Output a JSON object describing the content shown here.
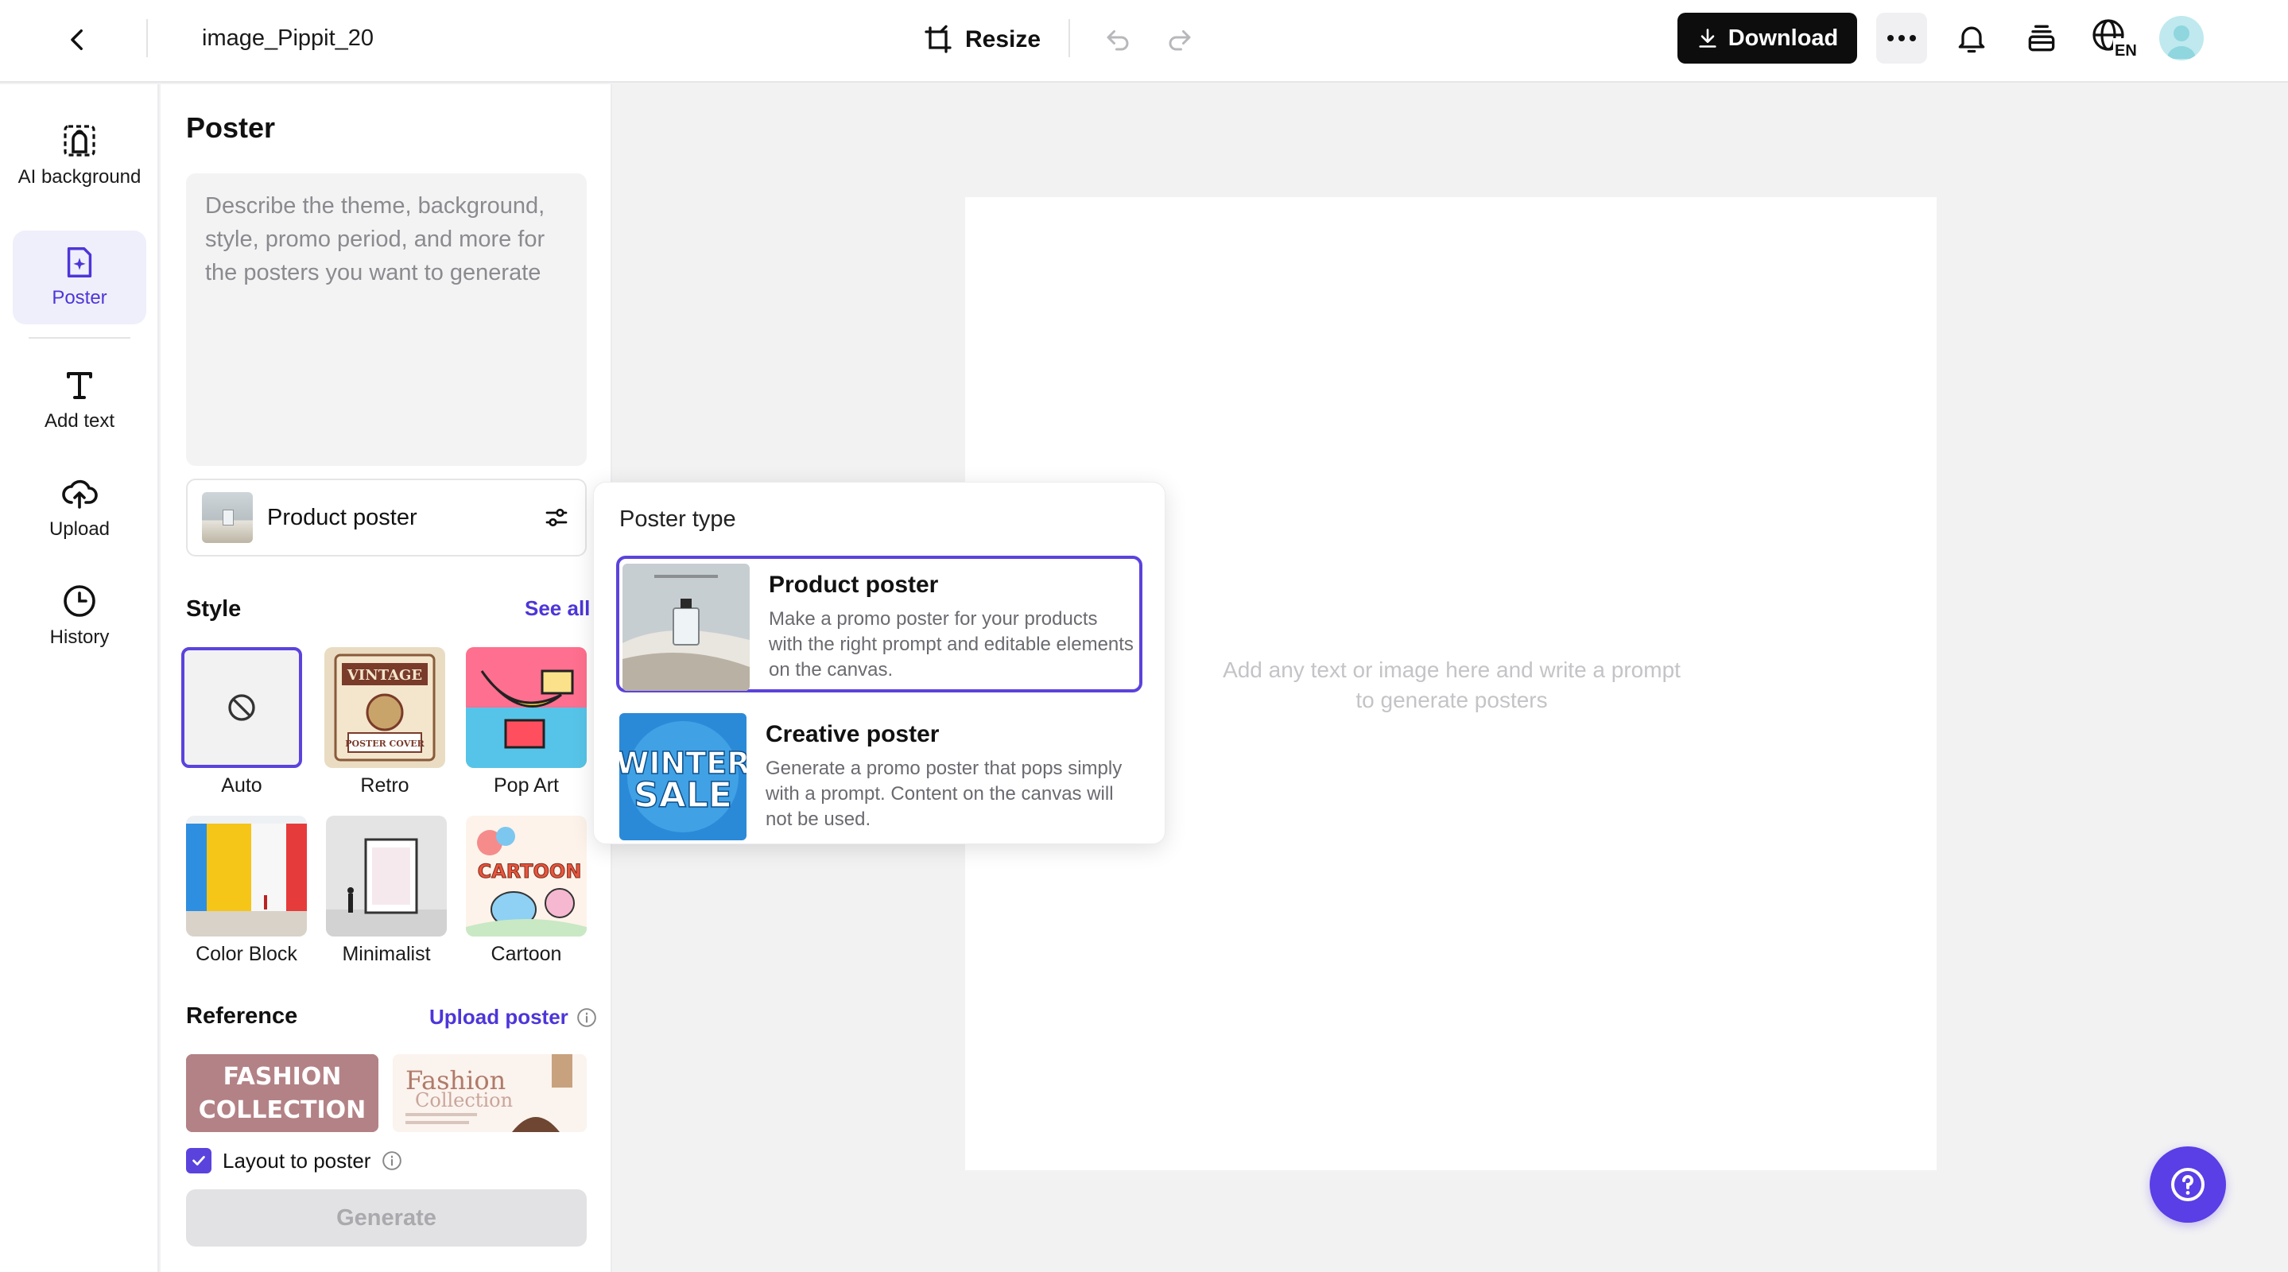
{
  "header": {
    "title": "image_Pippit_20",
    "resize_label": "Resize",
    "download_label": "Download",
    "language": "EN"
  },
  "rail": {
    "items": [
      {
        "label": "AI background",
        "icon": "ai-background-icon"
      },
      {
        "label": "Poster",
        "icon": "poster-icon",
        "active": true
      },
      {
        "label": "Add text",
        "icon": "text-icon"
      },
      {
        "label": "Upload",
        "icon": "upload-cloud-icon"
      },
      {
        "label": "History",
        "icon": "clock-icon"
      }
    ]
  },
  "panel": {
    "title": "Poster",
    "prompt_placeholder": "Describe the theme, background, style, promo period, and more for the posters you want to generate",
    "poster_type_selected": "Product poster",
    "style": {
      "title": "Style",
      "see_all": "See all",
      "options": [
        "Auto",
        "Retro",
        "Pop Art",
        "Color Block",
        "Minimalist",
        "Cartoon"
      ],
      "selected": "Auto"
    },
    "reference": {
      "title": "Reference",
      "upload_label": "Upload poster",
      "items": [
        {
          "text_line1": "FASHION",
          "text_line2": "COLLECTION"
        },
        {
          "text_line1": "Fashion",
          "text_line2": "Collection"
        }
      ]
    },
    "layout_to_poster": {
      "label": "Layout to poster",
      "checked": true
    },
    "generate_label": "Generate"
  },
  "canvas": {
    "hint": "Add any text or image here and write a prompt to generate posters"
  },
  "popover": {
    "title": "Poster type",
    "options": [
      {
        "title": "Product poster",
        "description": "Make a promo poster for your products with the right prompt and editable elements on the canvas.",
        "selected": true
      },
      {
        "title": "Creative poster",
        "description": "Generate a promo poster that pops simply with a prompt. Content on the canvas will not be used.",
        "image_text_line1": "WINTER",
        "image_text_line2": "SALE"
      }
    ]
  },
  "style_images": {
    "retro_line1": "VINTAGE",
    "retro_line2": "POSTER COVER",
    "cartoon_text": "CARTOON"
  },
  "colors": {
    "accent": "#5a43dd",
    "download_bg": "#0d0d0d",
    "help_bg": "#5a3ee6"
  }
}
